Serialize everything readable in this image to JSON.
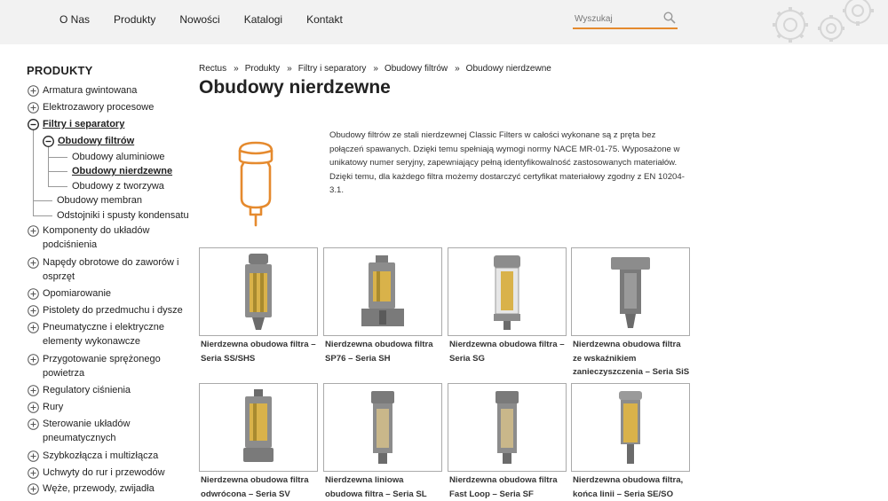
{
  "nav": {
    "items": [
      "O Nas",
      "Produkty",
      "Nowości",
      "Katalogi",
      "Kontakt"
    ]
  },
  "search": {
    "placeholder": "Wyszukaj"
  },
  "sidebar": {
    "title": "PRODUKTY",
    "items": [
      {
        "label": "Armatura gwintowana"
      },
      {
        "label": "Elektrozawory procesowe"
      },
      {
        "label": "Filtry i separatory"
      },
      {
        "label": "Obudowy filtrów"
      },
      {
        "label": "Obudowy aluminiowe"
      },
      {
        "label": "Obudowy nierdzewne"
      },
      {
        "label": "Obudowy z tworzywa"
      },
      {
        "label": "Obudowy membran"
      },
      {
        "label": "Odstojniki i spusty kondensatu"
      },
      {
        "label": "Komponenty do układów",
        "label2": "podciśnienia"
      },
      {
        "label": "Napędy obrotowe do zaworów i",
        "label2": "osprzęt"
      },
      {
        "label": "Opomiarowanie"
      },
      {
        "label": "Pistolety do przedmuchu i dysze"
      },
      {
        "label": "Pneumatyczne i elektryczne",
        "label2": "elementy wykonawcze"
      },
      {
        "label": "Przygotowanie sprężonego",
        "label2": "powietrza"
      },
      {
        "label": "Regulatory ciśnienia"
      },
      {
        "label": "Rury"
      },
      {
        "label": "Sterowanie układów",
        "label2": "pneumatycznych"
      },
      {
        "label": "Szybkozłącza i multizłącza"
      },
      {
        "label": "Uchwyty do rur i przewodów"
      },
      {
        "label": "Węże, przewody, zwijadła"
      }
    ]
  },
  "breadcrumb": [
    "Rectus",
    "Produkty",
    "Filtry i separatory",
    "Obudowy filtrów",
    "Obudowy nierdzewne"
  ],
  "breadcrumb_sep": "»",
  "page_title": "Obudowy nierdzewne",
  "description": "Obudowy filtrów ze stali nierdzewnej Classic Filters w całości wykonane są z pręta bez połączeń spawanych. Dzięki temu spełniają wymogi normy NACE MR-01-75. Wyposażone w unikatowy numer seryjny, zapewniający pełną identyfikowalność zastosowanych materiałów. Dzięki temu, dla każdego filtra możemy dostarczyć certyfikat materiałowy zgodny z EN 10204-3.1.",
  "products": [
    {
      "line1": "Nierdzewna obudowa filtra –",
      "line2": "Seria SS/SHS",
      "line3": ""
    },
    {
      "line1": "Nierdzewna obudowa filtra",
      "line2": "SP76 – Seria SH",
      "line3": ""
    },
    {
      "line1": "Nierdzewna obudowa filtra –",
      "line2": "Seria SG",
      "line3": ""
    },
    {
      "line1": "Nierdzewna obudowa filtra",
      "line2": "ze wskaźnikiem",
      "line3": "zanieczyszczenia – Seria SiS"
    },
    {
      "line1": "Nierdzewna obudowa filtra",
      "line2": "odwrócona – Seria SV",
      "line3": ""
    },
    {
      "line1": "Nierdzewna liniowa",
      "line2": "obudowa filtra – Seria SL",
      "line3": ""
    },
    {
      "line1": "Nierdzewna obudowa filtra",
      "line2": "Fast Loop – Seria SF",
      "line3": ""
    },
    {
      "line1": "Nierdzewna obudowa filtra,",
      "line2": "końca linii – Seria SE/SO",
      "line3": ""
    }
  ],
  "colors": {
    "accent": "#e58a2e",
    "header_bg": "#f2f2f2",
    "text": "#222222",
    "steel": "#8a8a8a",
    "filter_element": "#d9b24a"
  },
  "icons": [
    "search-icon",
    "gears-icon",
    "plus-circle-icon",
    "minus-circle-icon",
    "filter-housing-icon"
  ]
}
